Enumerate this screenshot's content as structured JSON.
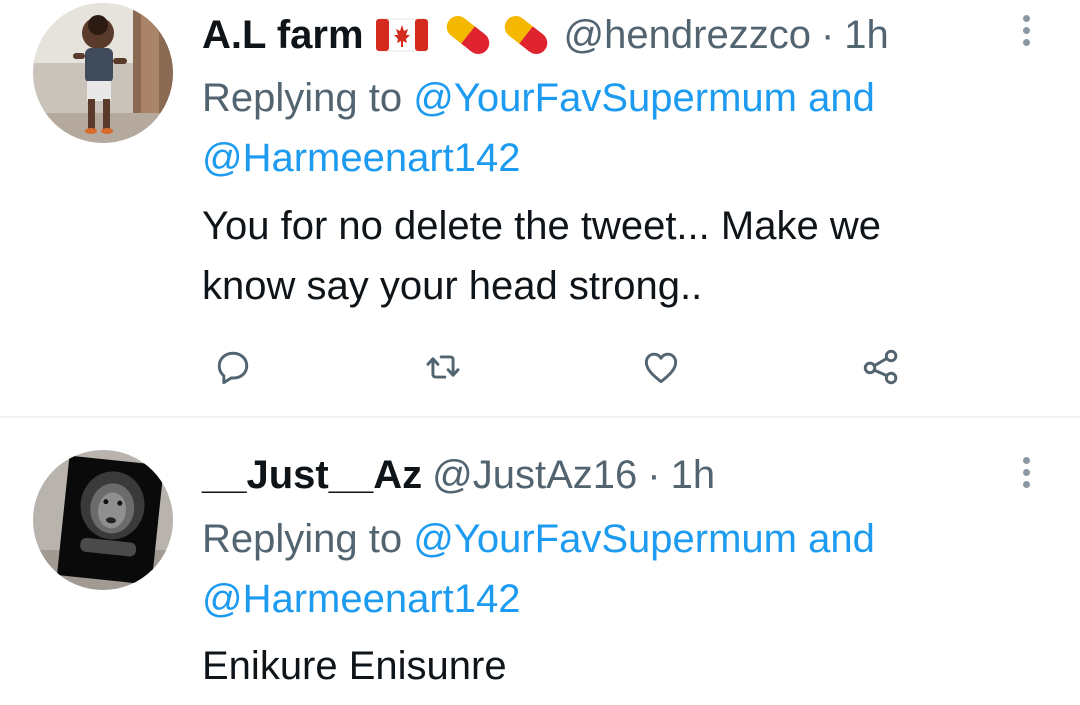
{
  "tweets": [
    {
      "display_name": "A.L farm",
      "flag_emoji": "canada-flag-icon",
      "pill_emojis": [
        "pill-icon",
        "pill-icon"
      ],
      "handle": "@hendrezzco",
      "separator": "·",
      "time": "1h",
      "replying_prefix": "Replying to",
      "reply_mention_1": "@YourFavSupermum",
      "reply_joiner": "and",
      "reply_mention_2": "@Harmeenart142",
      "text_line_1": "You for no delete the tweet... Make we",
      "text_line_2": "know say your head strong..",
      "actions": [
        "reply-icon",
        "retweet-icon",
        "like-icon",
        "share-icon"
      ]
    },
    {
      "display_name": "__Just__Az",
      "handle": "@JustAz16",
      "separator": "·",
      "time": "1h",
      "replying_prefix": "Replying to",
      "reply_mention_1": "@YourFavSupermum",
      "reply_joiner": "and",
      "reply_mention_2": "@Harmeenart142",
      "text_line_1": "Enikure Enisunre"
    }
  ],
  "colors": {
    "link": "#1d9bf0",
    "secondary_text": "#536471",
    "primary_text": "#0f1419",
    "divider": "#eff3f4",
    "icon": "#536471"
  }
}
